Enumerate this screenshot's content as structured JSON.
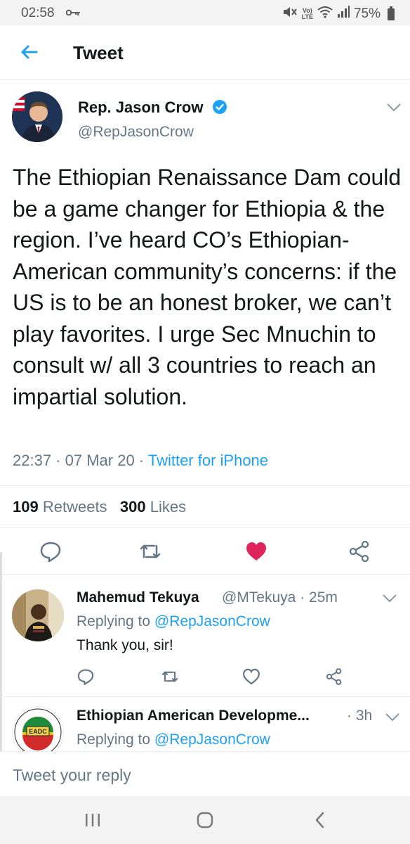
{
  "status_bar": {
    "time": "02:58",
    "battery": "75%",
    "network": "LTE",
    "key_icon": "key-icon",
    "icons": [
      "mute-icon",
      "wifi-icon",
      "signal-icon",
      "battery-icon"
    ]
  },
  "header": {
    "title": "Tweet",
    "back_icon": "arrow-left-icon"
  },
  "tweet": {
    "author_name": "Rep. Jason Crow",
    "handle": "@RepJasonCrow",
    "verified": true,
    "text": "The Ethiopian Renaissance Dam could be a game changer for Ethiopia & the region. I’ve heard CO’s Ethiopian-American community’s concerns: if the US is to be an honest broker, we can’t play favorites. I urge Sec Mnuchin to consult w/ all 3 countries to reach an impartial solution.",
    "time": "22:37",
    "date": "07 Mar 20",
    "source": "Twitter for iPhone",
    "retweet_count": "109",
    "retweet_label": "Retweets",
    "like_count": "300",
    "like_label": "Likes",
    "liked": true
  },
  "replies": [
    {
      "name": "Mahemud Tekuya",
      "handle": "@MTekuya",
      "time": "25m",
      "replying_label": "Replying to",
      "replying_to": "@RepJasonCrow",
      "text": "Thank you, sir!"
    },
    {
      "name": "Ethiopian American Developme...",
      "time": "3h",
      "replying_label": "Replying to",
      "replying_to": "@RepJasonCrow",
      "avatar_text": "EADC",
      "avatar_ring_text": "Ethiopian American Development Co"
    }
  ],
  "composer": {
    "placeholder": "Tweet your reply"
  },
  "nav_bar": {
    "buttons": [
      "recent-apps-icon",
      "home-icon",
      "back-icon"
    ]
  },
  "colors": {
    "accent": "#1da1f2",
    "like": "#e0245e",
    "secondary_text": "#657786",
    "primary_text": "#14171a",
    "divider": "#e6ecf0"
  }
}
